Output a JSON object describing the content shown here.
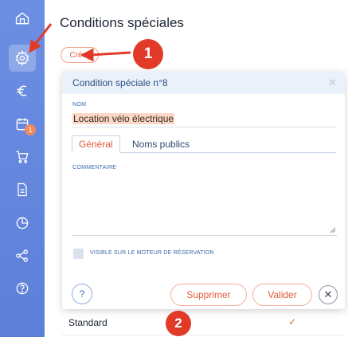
{
  "page": {
    "title": "Conditions spéciales"
  },
  "toolbar": {
    "create_label": "Créer"
  },
  "sidebar": {
    "items": [
      {
        "icon": "home-icon"
      },
      {
        "icon": "gear-icon",
        "active": true
      },
      {
        "icon": "euro-icon"
      },
      {
        "icon": "calendar-icon",
        "badge": "1"
      },
      {
        "icon": "cart-icon"
      },
      {
        "icon": "document-icon"
      },
      {
        "icon": "pie-chart-icon"
      },
      {
        "icon": "share-icon"
      },
      {
        "icon": "help-icon"
      }
    ]
  },
  "modal": {
    "title": "Condition spéciale n°8",
    "name_label": "NOM",
    "name_value": "Location vélo électrique",
    "tabs": [
      {
        "label": "Général"
      },
      {
        "label": "Noms publics"
      }
    ],
    "comment_label": "COMMENTAIRE",
    "comment_value": "",
    "checkbox_label": "VISIBLE SUR LE MOTEUR DE RÉSERVATION",
    "help_label": "?",
    "delete_label": "Supprimer",
    "validate_label": "Valider",
    "close_label": "✕"
  },
  "list": {
    "row_label": "Standard",
    "row_check": "✓"
  },
  "annotations": [
    {
      "label": "1"
    },
    {
      "label": "2"
    }
  ],
  "colors": {
    "sidebar": "#5d7fd8",
    "accent": "#e35b3a",
    "callout": "#e23a28",
    "header_bg": "#eaf1fb"
  }
}
